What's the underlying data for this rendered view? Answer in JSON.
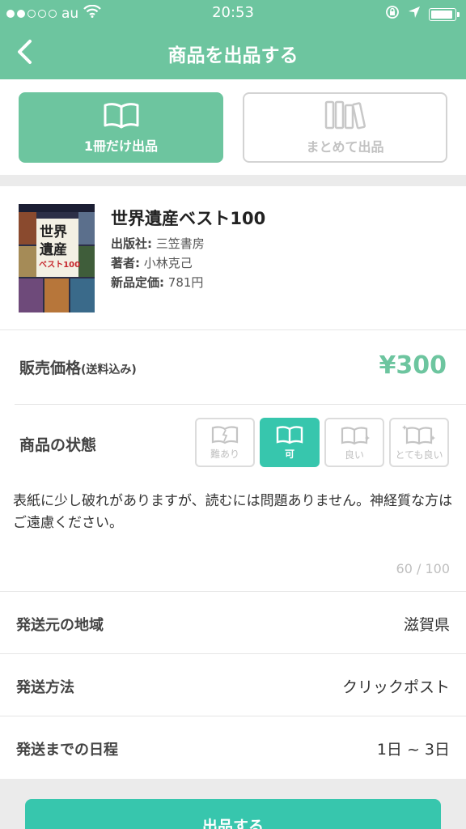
{
  "status_bar": {
    "carrier": "au",
    "time": "20:53"
  },
  "nav": {
    "title": "商品を出品する"
  },
  "mode_tabs": [
    {
      "label": "1冊だけ出品",
      "icon": "open-book-icon",
      "selected": true
    },
    {
      "label": "まとめて出品",
      "icon": "books-stack-icon",
      "selected": false
    }
  ],
  "book": {
    "title": "世界遺産ベスト100",
    "publisher_label": "出版社:",
    "publisher": "三笠書房",
    "author_label": "著者:",
    "author": "小林克己",
    "list_price_label": "新品定価:",
    "list_price": "781円",
    "cover_text": {
      "line1": "世界",
      "line2": "遺産",
      "line3": "ベスト100"
    }
  },
  "price": {
    "label": "販売価格",
    "note": "(送料込み)",
    "value": "¥300"
  },
  "condition": {
    "label": "商品の状態",
    "options": [
      {
        "label": "難あり",
        "selected": false
      },
      {
        "label": "可",
        "selected": true
      },
      {
        "label": "良い",
        "selected": false
      },
      {
        "label": "とても良い",
        "selected": false
      }
    ]
  },
  "description": {
    "text": "表紙に少し破れがありますが、読むには問題ありません。神経質な方はご遠慮ください。",
    "counter": "60 / 100"
  },
  "shipping": {
    "origin_label": "発送元の地域",
    "origin_value": "滋賀県",
    "method_label": "発送方法",
    "method_value": "クリックポスト",
    "schedule_label": "発送までの日程",
    "schedule_value": "1日 ~ 3日"
  },
  "submit": {
    "label": "出品する"
  },
  "colors": {
    "header": "#6dc59f",
    "accent": "#37c6ad",
    "price": "#6dc59f"
  }
}
